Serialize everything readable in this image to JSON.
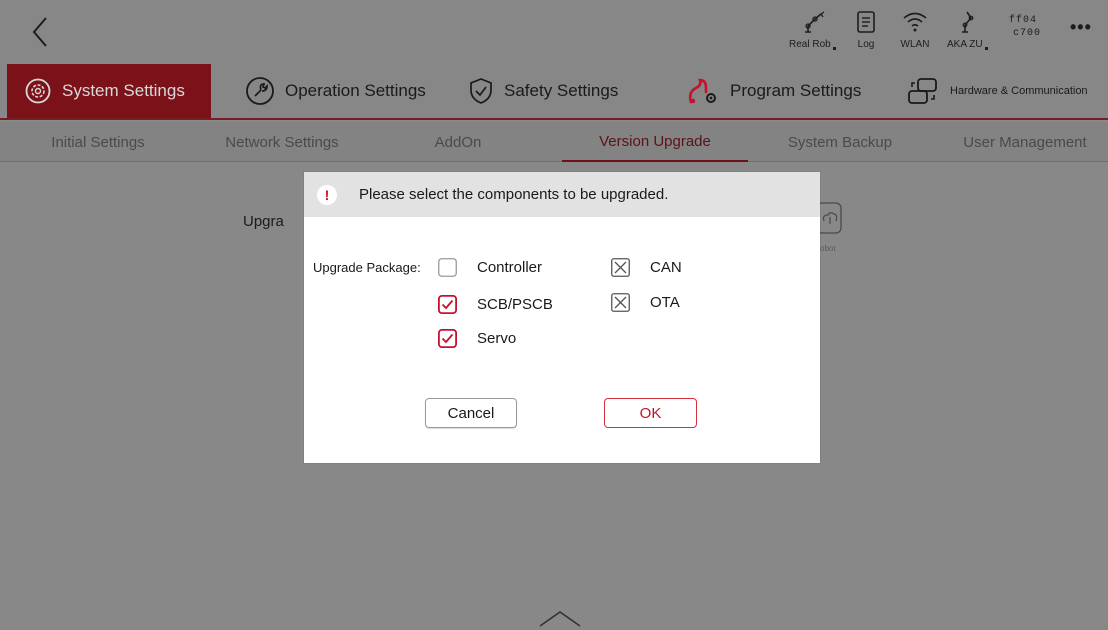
{
  "topbar": {
    "items": [
      {
        "icon": "robot-arm-icon",
        "label": "Real Rob"
      },
      {
        "icon": "log-icon",
        "label": "Log"
      },
      {
        "icon": "wifi-icon",
        "label": "WLAN"
      },
      {
        "icon": "robot-model-icon",
        "label": "AKA ZU"
      }
    ],
    "id_line1": "ff04",
    "id_line2": "c700",
    "more": "•••"
  },
  "main_tabs": [
    {
      "label": "System Settings",
      "icon": "gear-icon",
      "active": true
    },
    {
      "label": "Operation Settings",
      "icon": "wrench-icon"
    },
    {
      "label": "Safety Settings",
      "icon": "shield-icon"
    },
    {
      "label": "Program Settings",
      "icon": "program-icon"
    },
    {
      "label": "Hardware & Communication",
      "icon": "hardware-icon"
    }
  ],
  "sub_tabs": [
    {
      "label": "Initial Settings"
    },
    {
      "label": "Network Settings"
    },
    {
      "label": "AddOn"
    },
    {
      "label": "Version Upgrade",
      "active": true
    },
    {
      "label": "System Backup"
    },
    {
      "label": "User Management"
    }
  ],
  "background": {
    "label_partial": "Upgra",
    "caption_partial": "obot"
  },
  "dialog": {
    "title": "Please select the components to be upgraded.",
    "package_label": "Upgrade Package:",
    "options": [
      {
        "label": "Controller",
        "state": "unchecked"
      },
      {
        "label": "SCB/PSCB",
        "state": "checked"
      },
      {
        "label": "Servo",
        "state": "checked"
      },
      {
        "label": "CAN",
        "state": "disabled"
      },
      {
        "label": "OTA",
        "state": "disabled"
      }
    ],
    "cancel_label": "Cancel",
    "ok_label": "OK"
  },
  "colors": {
    "accent": "#c8102e",
    "active_tab_bg": "#7b1219",
    "overlay": "#878787"
  }
}
